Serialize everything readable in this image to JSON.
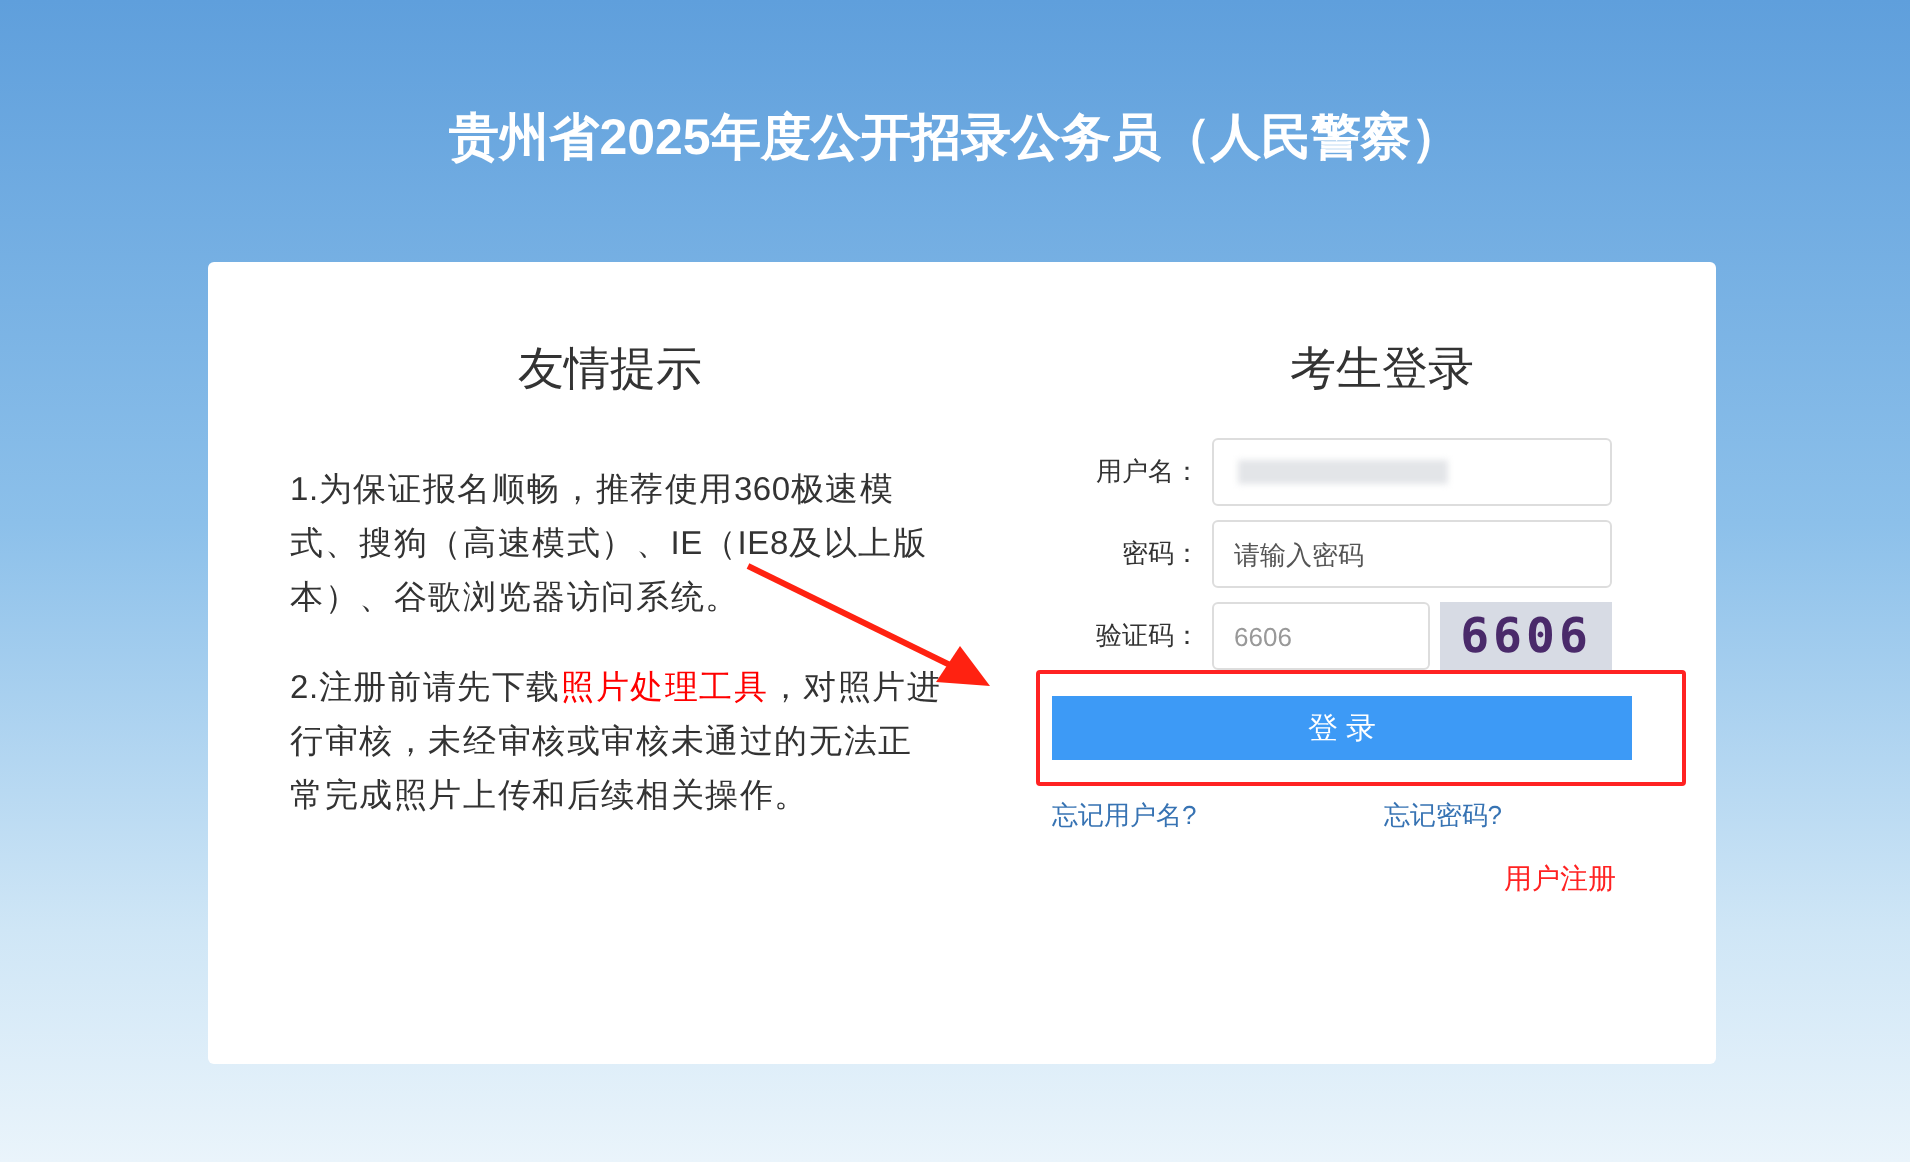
{
  "page_title": "贵州省2025年度公开招录公务员（人民警察）",
  "tips": {
    "heading": "友情提示",
    "paragraphs": [
      {
        "before": "1.为保证报名顺畅，推荐使用360极速模式、搜狗（高速模式）、IE（IE8及以上版本）、谷歌浏览器访问系统。"
      },
      {
        "before": "2.注册前请先下载",
        "link": "照片处理工具",
        "after": "，对照片进行审核，未经审核或审核未通过的无法正常完成照片上传和后续相关操作。"
      }
    ]
  },
  "login": {
    "heading": "考生登录",
    "fields": [
      {
        "kind": "blurred",
        "label": "用户名："
      },
      {
        "kind": "text",
        "label": "密码：",
        "placeholder": "请输入密码"
      },
      {
        "kind": "captcha",
        "label": "验证码：",
        "placeholder": "6606",
        "captcha": "6606"
      }
    ],
    "button": "登 录",
    "links": [
      "忘记用户名?",
      "忘记密码?"
    ],
    "register": "用户注册"
  }
}
